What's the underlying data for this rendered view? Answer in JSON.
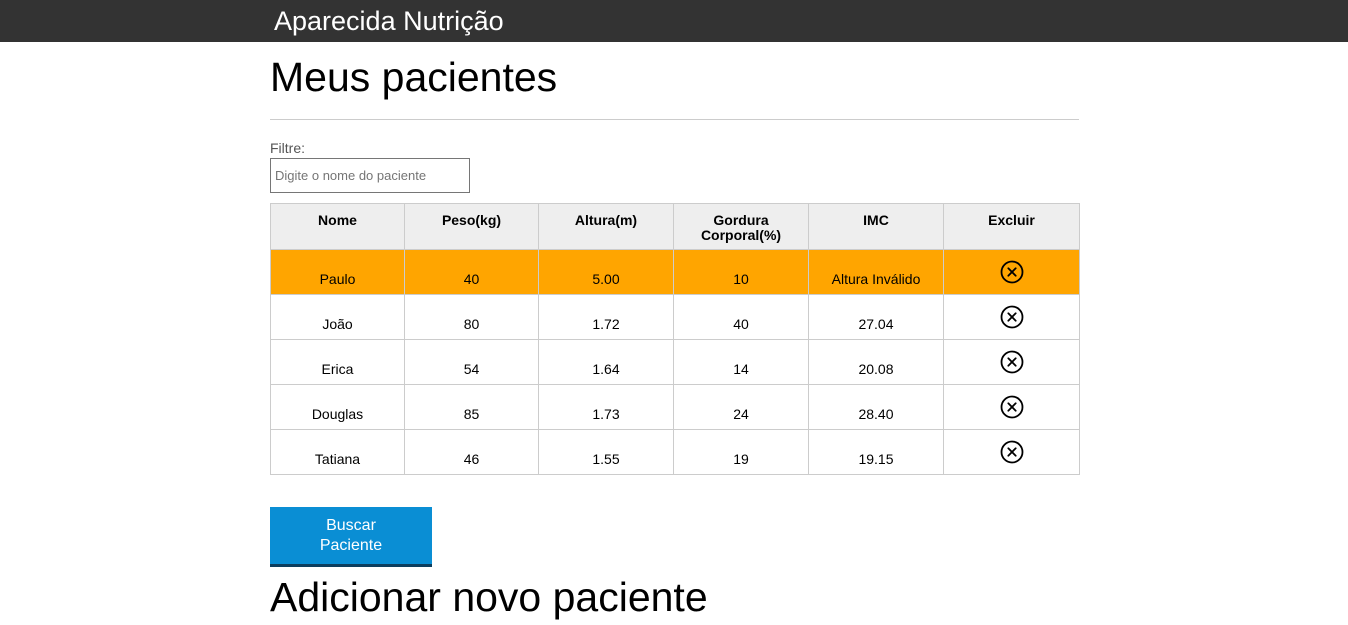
{
  "header": {
    "brand": "Aparecida Nutrição"
  },
  "main": {
    "title": "Meus pacientes",
    "filter": {
      "label": "Filtre:",
      "value": "",
      "placeholder": "Digite o nome do paciente"
    },
    "table": {
      "headers": {
        "nome": "Nome",
        "peso": "Peso(kg)",
        "altura": "Altura(m)",
        "gordura": "Gordura Corporal(%)",
        "imc": "IMC",
        "excluir": "Excluir"
      },
      "rows": [
        {
          "nome": "Paulo",
          "peso": "40",
          "altura": "5.00",
          "gordura": "10",
          "imc": "Altura Inválido",
          "status": "invalid"
        },
        {
          "nome": "João",
          "peso": "80",
          "altura": "1.72",
          "gordura": "40",
          "imc": "27.04",
          "status": "valid"
        },
        {
          "nome": "Erica",
          "peso": "54",
          "altura": "1.64",
          "gordura": "14",
          "imc": "20.08",
          "status": "valid"
        },
        {
          "nome": "Douglas",
          "peso": "85",
          "altura": "1.73",
          "gordura": "24",
          "imc": "28.40",
          "status": "valid"
        },
        {
          "nome": "Tatiana",
          "peso": "46",
          "altura": "1.55",
          "gordura": "19",
          "imc": "19.15",
          "status": "valid"
        }
      ],
      "delete_icon": "close-circle-icon",
      "invalid_row_color": "#ffa500",
      "header_bg_color": "#eeeeee"
    },
    "search_button": {
      "label": "Buscar Paciente",
      "color": "#0a8ed4"
    },
    "add_section_title": "Adicionar novo paciente"
  },
  "colors": {
    "topbar": "#333333"
  }
}
